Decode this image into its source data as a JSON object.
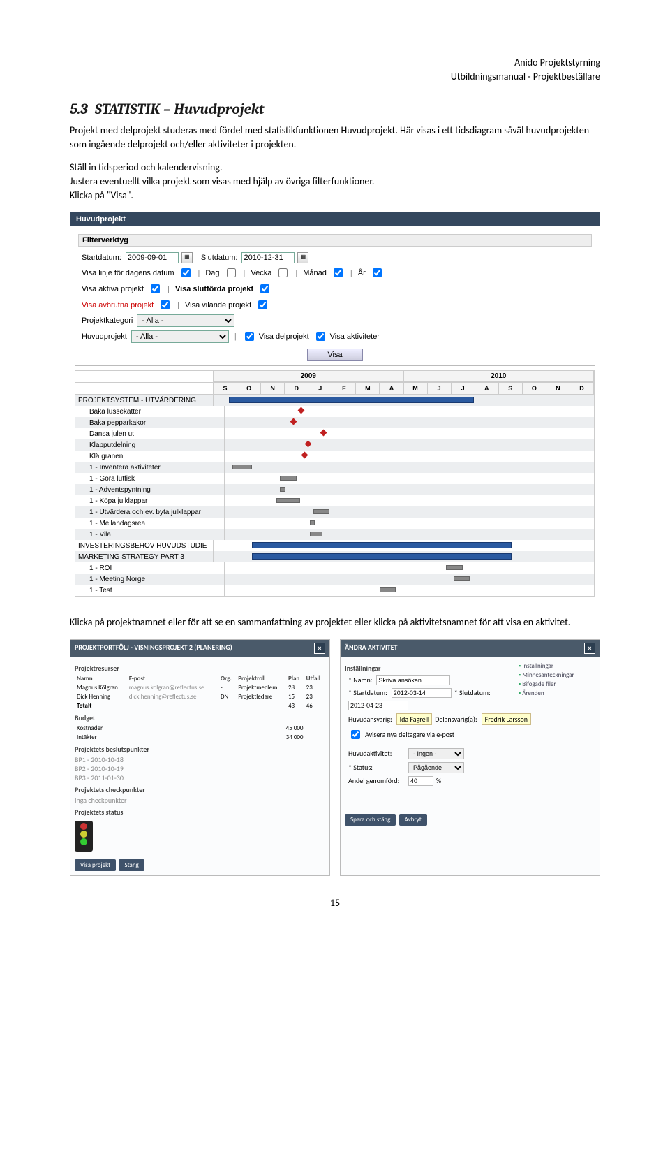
{
  "header": {
    "l1": "Anido Projektstyrning",
    "l2": "Utbildningsmanual - Projektbeställare"
  },
  "section": {
    "num": "5.3",
    "title": "STATISTIK – Huvudprojekt"
  },
  "para1": "Projekt med delprojekt studeras med fördel med statistikfunktionen Huvudprojekt. Här visas i ett tidsdiagram såväl huvudprojekten som ingående delprojekt och/eller aktiviteter i projekten.",
  "para2": "Ställ in tidsperiod och kalendervisning.",
  "para3": "Justera eventuellt vilka projekt som visas med hjälp av övriga filterfunktioner.",
  "para4": "Klicka på \"Visa\".",
  "para5": "Klicka på projektnamnet eller för att se en sammanfattning av projektet eller klicka på aktivitetsnamnet för att visa en aktivitet.",
  "shot1": {
    "title": "Huvudprojekt",
    "filter_head": "Filterverktyg",
    "start_lbl": "Startdatum:",
    "start_val": "2009-09-01",
    "end_lbl": "Slutdatum:",
    "end_val": "2010-12-31",
    "line_lbl": "Visa linje för dagens datum",
    "dag": "Dag",
    "vecka": "Vecka",
    "manad": "Månad",
    "ar": "År",
    "aktiva": "Visa aktiva projekt",
    "slutforda": "Visa slutförda projekt",
    "avbrutna": "Visa avbrutna projekt",
    "vilande": "Visa vilande projekt",
    "kat_lbl": "Projektkategori",
    "alla": "- Alla -",
    "huvud_lbl": "Huvudprojekt",
    "delproj": "Visa delprojekt",
    "aktiv": "Visa aktiviteter",
    "visa_btn": "Visa",
    "years": [
      "2009",
      "2010"
    ],
    "months": [
      "S",
      "O",
      "N",
      "D",
      "J",
      "F",
      "M",
      "A",
      "M",
      "J",
      "J",
      "A",
      "S",
      "O",
      "N",
      "D"
    ],
    "rows": [
      {
        "label": "PROJEKTSYSTEM - UTVÄRDERING",
        "type": "bar",
        "start": 4,
        "end": 68,
        "pad": false
      },
      {
        "label": "Baka lussekatter",
        "type": "dia",
        "pos": 20,
        "pad": true
      },
      {
        "label": "Baka pepparkakor",
        "type": "dia",
        "pos": 18,
        "pad": true
      },
      {
        "label": "Dansa julen ut",
        "type": "dia",
        "pos": 26,
        "pad": true
      },
      {
        "label": "Klapputdelning",
        "type": "dia",
        "pos": 22,
        "pad": true
      },
      {
        "label": "Klä granen",
        "type": "dia",
        "pos": 21,
        "pad": true
      },
      {
        "label": "1 - Inventera aktiviteter",
        "type": "sm",
        "start": 2,
        "end": 7,
        "pad": true
      },
      {
        "label": "1 - Göra lutfisk",
        "type": "sm",
        "start": 15,
        "end": 19,
        "pad": true
      },
      {
        "label": "1 - Adventspyntning",
        "type": "sm",
        "start": 15,
        "end": 16,
        "pad": true
      },
      {
        "label": "1 - Köpa julklappar",
        "type": "sm",
        "start": 14,
        "end": 20,
        "pad": true
      },
      {
        "label": "1 - Utvärdera och ev. byta julklappar",
        "type": "sm",
        "start": 24,
        "end": 28,
        "pad": true
      },
      {
        "label": "1 - Mellandagsrea",
        "type": "sm",
        "start": 23,
        "end": 24,
        "pad": true
      },
      {
        "label": "1 - Vila",
        "type": "sm",
        "start": 23,
        "end": 26,
        "pad": true
      },
      {
        "label": "INVESTERINGSBEHOV HUVUDSTUDIE",
        "type": "bar",
        "start": 10,
        "end": 78,
        "pad": false
      },
      {
        "label": "MARKETING STRATEGY PART 3",
        "type": "bar",
        "start": 10,
        "end": 78,
        "pad": false
      },
      {
        "label": "1 - ROI",
        "type": "sm",
        "start": 60,
        "end": 64,
        "pad": true
      },
      {
        "label": "   1 - Meeting Norge",
        "type": "sm",
        "start": 62,
        "end": 66,
        "pad": true
      },
      {
        "label": "1 - Test",
        "type": "sm",
        "start": 42,
        "end": 46,
        "pad": true
      }
    ]
  },
  "card1": {
    "title": "PROJEKTPORTFÖLJ - VISNINGSPROJEKT 2 (PLANERING)",
    "res_head": "Projektresurser",
    "cols": [
      "Namn",
      "E-post",
      "Org.",
      "Projektroll",
      "Plan",
      "Utfall"
    ],
    "rows": [
      [
        "Magnus Kölgran",
        "magnus.kolgran@reflectus.se",
        "-",
        "Projektmedlem",
        "28",
        "23"
      ],
      [
        "Dick Henning",
        "dick.henning@reflectus.se",
        "DN",
        "Projektledare",
        "15",
        "23"
      ]
    ],
    "totalt_lbl": "Totalt",
    "totalt_plan": "43",
    "totalt_utfall": "46",
    "budget": "Budget",
    "kost_lbl": "Kostnader",
    "kost": "45 000",
    "int_lbl": "Intäkter",
    "int": "34 000",
    "besluts": "Projektets beslutspunkter",
    "bp": [
      "BP1 - 2010-10-18",
      "BP2 - 2010-10-19",
      "BP3 - 2011-01-30"
    ],
    "check": "Projektets checkpunkter",
    "check_none": "Inga checkpunkter",
    "status": "Projektets status",
    "btn_visa": "Visa projekt",
    "btn_stang": "Stäng"
  },
  "card2": {
    "title": "ÄNDRA AKTIVITET",
    "inst": "Inställningar",
    "namn_lbl": "* Namn:",
    "namn_val": "Skriva ansökan",
    "start_lbl": "* Startdatum:",
    "start_val": "2012-03-14",
    "slut_lbl": "* Slutdatum:",
    "slut_val": "2012-04-23",
    "huvud_lbl": "Huvudansvarig:",
    "huvud_val": "Ida Fagrell",
    "del_lbl": "Delansvarig(a):",
    "del_val": "Fredrik Larsson",
    "avisera": "Avisera nya deltagare via e-post",
    "hakt_lbl": "Huvudaktivitet:",
    "hakt_val": "- Ingen -",
    "stat_lbl": "* Status:",
    "stat_val": "Pågående",
    "andel_lbl": "Andel genomförd:",
    "andel_val": "40",
    "andel_unit": "%",
    "links": [
      "Inställningar",
      "Minnesanteckningar",
      "Bifogade filer",
      "Ärenden"
    ],
    "btn_spara": "Spara och stäng",
    "btn_avbryt": "Avbryt"
  },
  "page_num": "15"
}
